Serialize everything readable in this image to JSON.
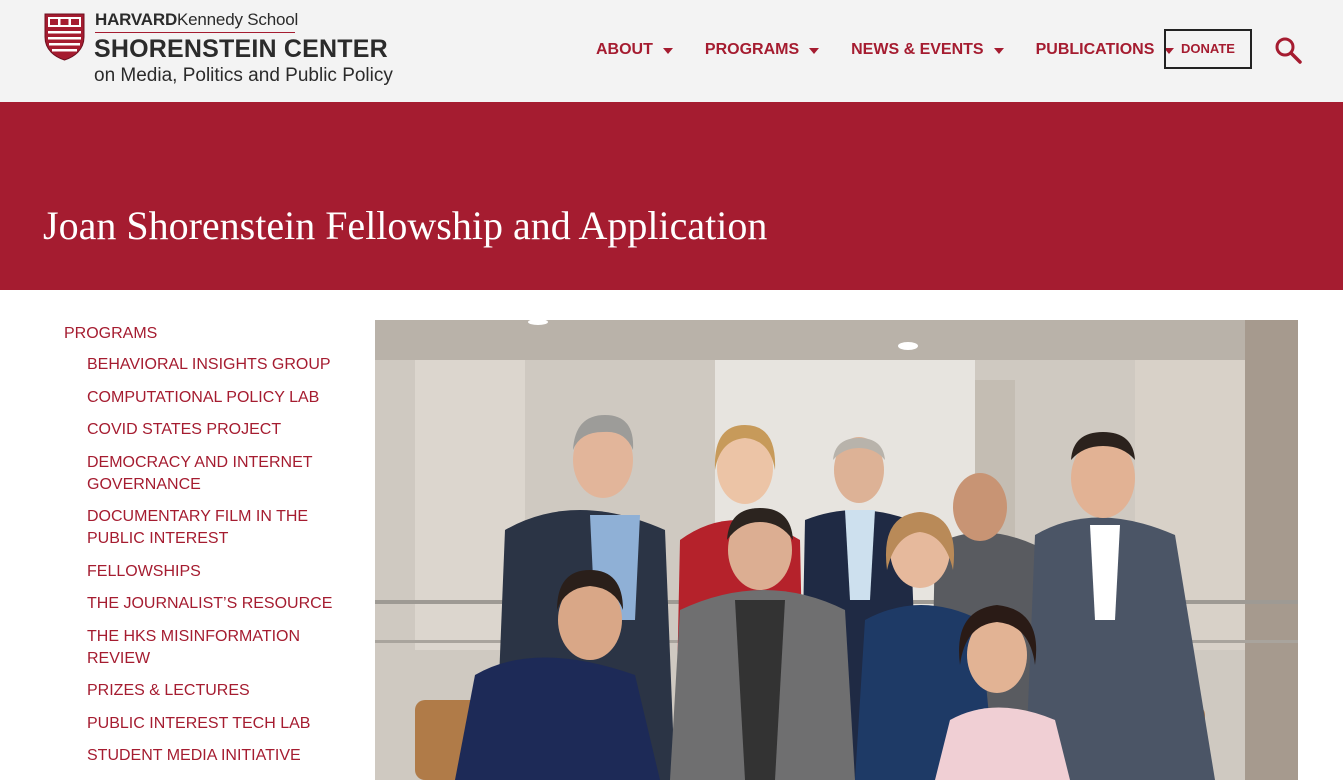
{
  "logo": {
    "school_bold": "HARVARD",
    "school_rest": "Kennedy School",
    "center": "SHORENSTEIN CENTER",
    "tagline": "on Media, Politics and Public Policy"
  },
  "nav": {
    "items": [
      {
        "label": "ABOUT"
      },
      {
        "label": "PROGRAMS"
      },
      {
        "label": "NEWS & EVENTS"
      },
      {
        "label": "PUBLICATIONS"
      }
    ],
    "donate_label": "DONATE"
  },
  "hero": {
    "title": "Joan Shorenstein Fellowship and Application"
  },
  "sidebar": {
    "heading": "PROGRAMS",
    "items": [
      {
        "label": "BEHAVIORAL INSIGHTS GROUP"
      },
      {
        "label": "COMPUTATIONAL POLICY LAB"
      },
      {
        "label": "COVID STATES PROJECT"
      },
      {
        "label": "DEMOCRACY AND INTERNET GOVERNANCE"
      },
      {
        "label": "DOCUMENTARY FILM IN THE PUBLIC INTEREST"
      },
      {
        "label": "FELLOWSHIPS"
      },
      {
        "label": "THE JOURNALIST’S RESOURCE"
      },
      {
        "label": "THE HKS MISINFORMATION REVIEW"
      },
      {
        "label": "PRIZES & LECTURES"
      },
      {
        "label": "PUBLIC INTEREST TECH LAB"
      },
      {
        "label": "STUDENT MEDIA INITIATIVE"
      }
    ]
  },
  "colors": {
    "crimson": "#a51c30",
    "header_bg": "#f3f3f3",
    "text_dark": "#2b2b2b"
  },
  "icons": {
    "search": "search-icon",
    "caret": "caret-down-icon",
    "shield": "harvard-shield-icon"
  }
}
